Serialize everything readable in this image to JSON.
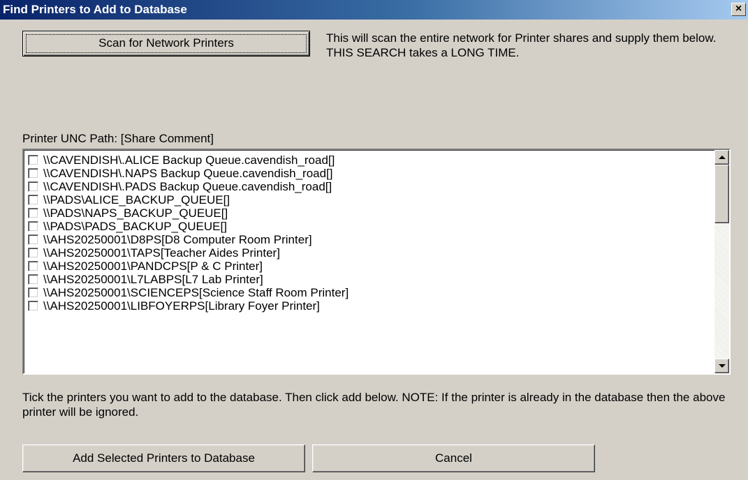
{
  "window": {
    "title": "Find Printers to Add to Database",
    "close_glyph": "×"
  },
  "scan": {
    "button_label": "Scan for Network Printers",
    "description": "This will scan the entire network for Printer shares and supply them below. THIS SEARCH takes a LONG TIME."
  },
  "list": {
    "header": "Printer UNC Path: [Share Comment]",
    "items": [
      {
        "label": "\\\\CAVENDISH\\.ALICE Backup Queue.cavendish_road[]",
        "checked": false
      },
      {
        "label": "\\\\CAVENDISH\\.NAPS Backup Queue.cavendish_road[]",
        "checked": false
      },
      {
        "label": "\\\\CAVENDISH\\.PADS Backup Queue.cavendish_road[]",
        "checked": false
      },
      {
        "label": "\\\\PADS\\ALICE_BACKUP_QUEUE[]",
        "checked": false
      },
      {
        "label": "\\\\PADS\\NAPS_BACKUP_QUEUE[]",
        "checked": false
      },
      {
        "label": "\\\\PADS\\PADS_BACKUP_QUEUE[]",
        "checked": false
      },
      {
        "label": "\\\\AHS20250001\\D8PS[D8 Computer Room Printer]",
        "checked": false
      },
      {
        "label": "\\\\AHS20250001\\TAPS[Teacher Aides Printer]",
        "checked": false
      },
      {
        "label": "\\\\AHS20250001\\PANDCPS[P & C Printer]",
        "checked": false
      },
      {
        "label": "\\\\AHS20250001\\L7LABPS[L7 Lab Printer]",
        "checked": false
      },
      {
        "label": "\\\\AHS20250001\\SCIENCEPS[Science Staff Room Printer]",
        "checked": false
      },
      {
        "label": "\\\\AHS20250001\\LIBFOYERPS[Library Foyer Printer]",
        "checked": false
      }
    ]
  },
  "instructions": "Tick the printers you want to add to the database. Then click add below. NOTE: If the printer is already in the database then the above printer will be ignored.",
  "actions": {
    "add_label": "Add Selected Printers to Database",
    "cancel_label": "Cancel"
  },
  "colors": {
    "title_gradient_start": "#0a246a",
    "title_gradient_end": "#a6caf0",
    "face": "#d4d0c8"
  }
}
